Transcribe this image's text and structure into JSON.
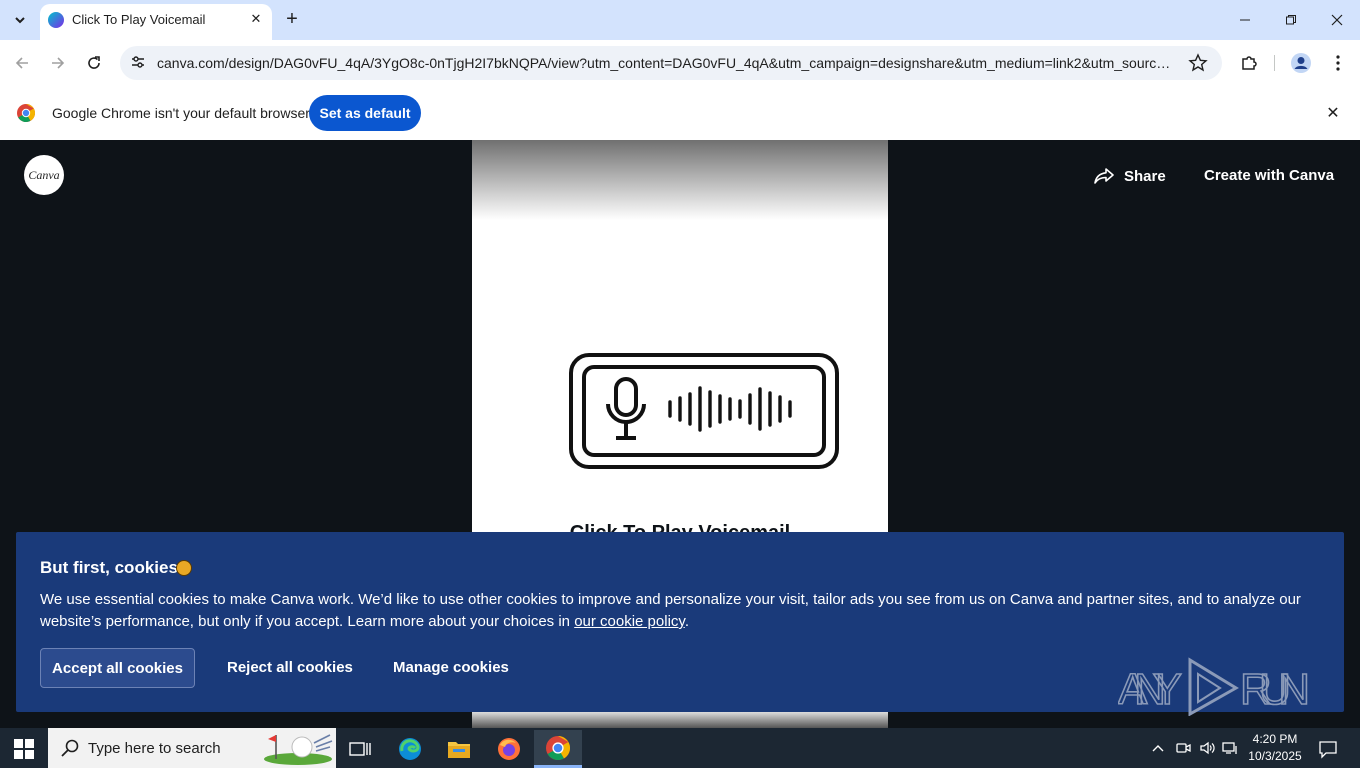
{
  "browser": {
    "tab_title": "Click To Play Voicemail",
    "url": "canva.com/design/DAG0vFU_4qA/3YgO8c-0nTjgH2I7bkNQPA/view?utm_content=DAG0vFU_4qA&utm_campaign=designshare&utm_medium=link2&utm_source=...",
    "infobar_text": "Google Chrome isn't your default browser",
    "set_default_label": "Set as default"
  },
  "canva": {
    "logo_text": "Canva",
    "share_label": "Share",
    "create_label": "Create with Canva",
    "page_title": "Click To Play Voicemail"
  },
  "cookie_banner": {
    "title": "But first, cookies",
    "body": "We use essential cookies to make Canva work. We’d like to use other cookies to improve and personalize your visit, tailor ads you see from us on Canva and partner sites, and to analyze our website’s performance, but only if you accept. Learn more about your choices in ",
    "policy_link": "our cookie policy",
    "period": ".",
    "accept_label": "Accept all cookies",
    "reject_label": "Reject all cookies",
    "manage_label": "Manage cookies"
  },
  "watermark": {
    "text_left": "ANY",
    "text_right": "RUN"
  },
  "taskbar": {
    "search_placeholder": "Type here to search",
    "time": "4:20 PM",
    "date": "10/3/2025"
  }
}
